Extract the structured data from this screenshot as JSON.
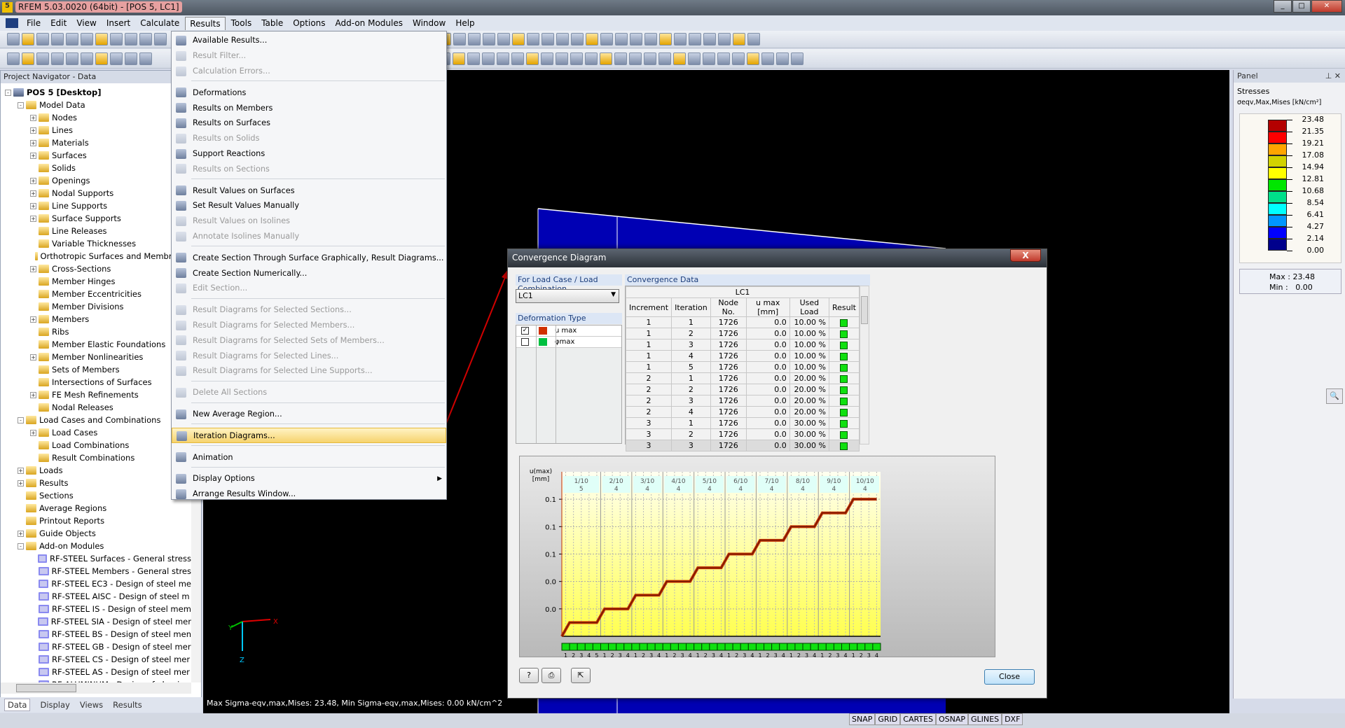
{
  "window": {
    "title": "RFEM 5.03.0020 (64bit) - [POS 5, LC1]"
  },
  "menubar": [
    "File",
    "Edit",
    "View",
    "Insert",
    "Calculate",
    "Results",
    "Tools",
    "Table",
    "Options",
    "Add-on Modules",
    "Window",
    "Help"
  ],
  "active_menu": "Results",
  "results_menu": [
    {
      "label": "Available Results...",
      "icon": "available-results-icon"
    },
    {
      "label": "Result Filter...",
      "disabled": true,
      "icon": "filter-icon"
    },
    {
      "label": "Calculation Errors...",
      "disabled": true,
      "icon": "warning-icon"
    },
    {
      "sep": true
    },
    {
      "label": "Deformations",
      "icon": "deformations-icon"
    },
    {
      "label": "Results on Members",
      "icon": "member-results-icon"
    },
    {
      "label": "Results on Surfaces",
      "icon": "surface-results-icon"
    },
    {
      "label": "Results on Solids",
      "disabled": true,
      "icon": "solid-results-icon"
    },
    {
      "label": "Support Reactions",
      "icon": "support-reactions-icon"
    },
    {
      "label": "Results on Sections",
      "disabled": true,
      "icon": "section-results-icon"
    },
    {
      "sep": true
    },
    {
      "label": "Result Values on Surfaces",
      "icon": "result-values-icon"
    },
    {
      "label": "Set Result Values Manually",
      "icon": "set-values-icon"
    },
    {
      "label": "Result Values on Isolines",
      "disabled": true,
      "icon": "isolines-icon"
    },
    {
      "label": "Annotate Isolines Manually",
      "disabled": true,
      "icon": "annotate-icon"
    },
    {
      "sep": true
    },
    {
      "label": "Create Section Through Surface Graphically, Result Diagrams...",
      "icon": "section-graphic-icon"
    },
    {
      "label": "Create Section Numerically...",
      "icon": "section-numeric-icon"
    },
    {
      "label": "Edit Section...",
      "disabled": true,
      "icon": "edit-section-icon"
    },
    {
      "sep": true
    },
    {
      "label": "Result Diagrams for Selected Sections...",
      "disabled": true,
      "icon": "diagram-icon"
    },
    {
      "label": "Result Diagrams for Selected Members...",
      "disabled": true,
      "icon": "diagram-icon"
    },
    {
      "label": "Result Diagrams for Selected Sets of Members...",
      "disabled": true,
      "icon": "diagram-icon"
    },
    {
      "label": "Result Diagrams for Selected Lines...",
      "disabled": true,
      "icon": "diagram-icon"
    },
    {
      "label": "Result Diagrams for Selected Line Supports...",
      "disabled": true,
      "icon": "diagram-icon"
    },
    {
      "sep": true
    },
    {
      "label": "Delete All Sections",
      "disabled": true,
      "icon": "delete-icon"
    },
    {
      "sep": true
    },
    {
      "label": "New Average Region...",
      "icon": "average-region-icon"
    },
    {
      "sep": true
    },
    {
      "label": "Iteration Diagrams...",
      "highlighted": true,
      "icon": "iteration-diagram-icon"
    },
    {
      "sep": true
    },
    {
      "label": "Animation",
      "icon": "animation-icon"
    },
    {
      "sep": true
    },
    {
      "label": "Display Options",
      "submenu": true,
      "icon": "display-options-icon"
    },
    {
      "label": "Arrange Results Window...",
      "icon": "arrange-icon"
    }
  ],
  "navigator": {
    "title": "Project Navigator - Data",
    "tree": [
      {
        "label": "POS 5 [Desktop]",
        "level": 0,
        "bold": true,
        "exp": "-"
      },
      {
        "label": "Model Data",
        "level": 1,
        "exp": "-"
      },
      {
        "label": "Nodes",
        "level": 2,
        "exp": "+"
      },
      {
        "label": "Lines",
        "level": 2,
        "exp": "+"
      },
      {
        "label": "Materials",
        "level": 2,
        "exp": "+"
      },
      {
        "label": "Surfaces",
        "level": 2,
        "exp": "+"
      },
      {
        "label": "Solids",
        "level": 2
      },
      {
        "label": "Openings",
        "level": 2,
        "exp": "+"
      },
      {
        "label": "Nodal Supports",
        "level": 2,
        "exp": "+"
      },
      {
        "label": "Line Supports",
        "level": 2,
        "exp": "+"
      },
      {
        "label": "Surface Supports",
        "level": 2,
        "exp": "+"
      },
      {
        "label": "Line Releases",
        "level": 2
      },
      {
        "label": "Variable Thicknesses",
        "level": 2
      },
      {
        "label": "Orthotropic Surfaces and Membranes",
        "level": 2
      },
      {
        "label": "Cross-Sections",
        "level": 2,
        "exp": "+"
      },
      {
        "label": "Member Hinges",
        "level": 2
      },
      {
        "label": "Member Eccentricities",
        "level": 2
      },
      {
        "label": "Member Divisions",
        "level": 2
      },
      {
        "label": "Members",
        "level": 2,
        "exp": "+"
      },
      {
        "label": "Ribs",
        "level": 2
      },
      {
        "label": "Member Elastic Foundations",
        "level": 2
      },
      {
        "label": "Member Nonlinearities",
        "level": 2,
        "exp": "+"
      },
      {
        "label": "Sets of Members",
        "level": 2
      },
      {
        "label": "Intersections of Surfaces",
        "level": 2
      },
      {
        "label": "FE Mesh Refinements",
        "level": 2,
        "exp": "+"
      },
      {
        "label": "Nodal Releases",
        "level": 2
      },
      {
        "label": "Load Cases and Combinations",
        "level": 1,
        "exp": "-"
      },
      {
        "label": "Load Cases",
        "level": 2,
        "exp": "+"
      },
      {
        "label": "Load Combinations",
        "level": 2
      },
      {
        "label": "Result Combinations",
        "level": 2
      },
      {
        "label": "Loads",
        "level": 1,
        "exp": "+"
      },
      {
        "label": "Results",
        "level": 1,
        "exp": "+"
      },
      {
        "label": "Sections",
        "level": 1
      },
      {
        "label": "Average Regions",
        "level": 1
      },
      {
        "label": "Printout Reports",
        "level": 1
      },
      {
        "label": "Guide Objects",
        "level": 1,
        "exp": "+"
      },
      {
        "label": "Add-on Modules",
        "level": 1,
        "exp": "-"
      },
      {
        "label": "RF-STEEL Surfaces - General stress",
        "level": 2,
        "mod": true
      },
      {
        "label": "RF-STEEL Members - General stres",
        "level": 2,
        "mod": true
      },
      {
        "label": "RF-STEEL EC3 - Design of steel me",
        "level": 2,
        "mod": true
      },
      {
        "label": "RF-STEEL AISC - Design of steel m",
        "level": 2,
        "mod": true
      },
      {
        "label": "RF-STEEL IS - Design of steel mem",
        "level": 2,
        "mod": true
      },
      {
        "label": "RF-STEEL SIA - Design of steel mer",
        "level": 2,
        "mod": true
      },
      {
        "label": "RF-STEEL BS - Design of steel men",
        "level": 2,
        "mod": true
      },
      {
        "label": "RF-STEEL GB - Design of steel mer",
        "level": 2,
        "mod": true
      },
      {
        "label": "RF-STEEL CS - Design of steel mer",
        "level": 2,
        "mod": true
      },
      {
        "label": "RF-STEEL AS - Design of steel mer",
        "level": 2,
        "mod": true
      },
      {
        "label": "RF-ALUMINUM - Design of alumi",
        "level": 2,
        "mod": true
      }
    ],
    "tabs": [
      "Data",
      "Display",
      "Views",
      "Results"
    ]
  },
  "viewport": {
    "status": "Max Sigma-eqv,max,Mises: 23.48, Min Sigma-eqv,max,Mises: 0.00 kN/cm^2",
    "axis_y": "Y",
    "axis_x": "X",
    "axis_z": "Z"
  },
  "panel": {
    "title": "Panel",
    "heading": "Stresses",
    "quantity": "σeqv,Max,Mises [kN/cm²]",
    "legend_values": [
      "23.48",
      "21.35",
      "19.21",
      "17.08",
      "14.94",
      "12.81",
      "10.68",
      "8.54",
      "6.41",
      "4.27",
      "2.14",
      "0.00"
    ],
    "legend_colors": [
      "#b40000",
      "#ff0000",
      "#ffa500",
      "#d2d200",
      "#ffff00",
      "#00e600",
      "#00e08a",
      "#00ffff",
      "#0096ff",
      "#0000ff",
      "#00008c"
    ],
    "max_label": "Max",
    "max": "23.48",
    "min_label": "Min",
    "min": "0.00"
  },
  "statusbar": [
    "SNAP",
    "GRID",
    "CARTES",
    "OSNAP",
    "GLINES",
    "DXF"
  ],
  "dialog": {
    "title": "Convergence Diagram",
    "load_case_header": "For Load Case / Load Combination",
    "load_case": "LC1",
    "deformation_header": "Deformation Type",
    "deformations": [
      {
        "label": "u max",
        "checked": true,
        "color": "#d03000"
      },
      {
        "label": "φmax",
        "checked": false,
        "color": "#00c040"
      }
    ],
    "data_header": "Convergence Data",
    "table_group": "LC1",
    "columns": [
      "Increment",
      "Iteration",
      "Node No.",
      "u max [mm]",
      "Used Load",
      "Result"
    ],
    "rows": [
      [
        "1",
        "1",
        "1726",
        "0.0",
        "10.00 %"
      ],
      [
        "1",
        "2",
        "1726",
        "0.0",
        "10.00 %"
      ],
      [
        "1",
        "3",
        "1726",
        "0.0",
        "10.00 %"
      ],
      [
        "1",
        "4",
        "1726",
        "0.0",
        "10.00 %"
      ],
      [
        "1",
        "5",
        "1726",
        "0.0",
        "10.00 %"
      ],
      [
        "2",
        "1",
        "1726",
        "0.0",
        "20.00 %"
      ],
      [
        "2",
        "2",
        "1726",
        "0.0",
        "20.00 %"
      ],
      [
        "2",
        "3",
        "1726",
        "0.0",
        "20.00 %"
      ],
      [
        "2",
        "4",
        "1726",
        "0.0",
        "20.00 %"
      ],
      [
        "3",
        "1",
        "1726",
        "0.0",
        "30.00 %"
      ],
      [
        "3",
        "2",
        "1726",
        "0.0",
        "30.00 %"
      ],
      [
        "3",
        "3",
        "1726",
        "0.0",
        "30.00 %"
      ]
    ],
    "result_color": "#10e010",
    "close_label": "Close"
  },
  "chart_data": {
    "type": "line",
    "ylabel": "u(max)\n[mm]",
    "ytick_labels": [
      "0.0",
      "0.0",
      "0.1",
      "0.1",
      "0.1"
    ],
    "yticks": [
      0.02,
      0.04,
      0.06,
      0.08,
      0.1
    ],
    "ylim": [
      0,
      0.12
    ],
    "increments": [
      {
        "label": "1/10",
        "iterations": 5,
        "values": [
          0,
          0.01,
          0.01,
          0.01,
          0.01
        ]
      },
      {
        "label": "2/10",
        "iterations": 4,
        "values": [
          0.02,
          0.02,
          0.02,
          0.02
        ]
      },
      {
        "label": "3/10",
        "iterations": 4,
        "values": [
          0.03,
          0.03,
          0.03,
          0.03
        ]
      },
      {
        "label": "4/10",
        "iterations": 4,
        "values": [
          0.04,
          0.04,
          0.04,
          0.04
        ]
      },
      {
        "label": "5/10",
        "iterations": 4,
        "values": [
          0.05,
          0.05,
          0.05,
          0.05
        ]
      },
      {
        "label": "6/10",
        "iterations": 4,
        "values": [
          0.06,
          0.06,
          0.06,
          0.06
        ]
      },
      {
        "label": "7/10",
        "iterations": 4,
        "values": [
          0.07,
          0.07,
          0.07,
          0.07
        ]
      },
      {
        "label": "8/10",
        "iterations": 4,
        "values": [
          0.08,
          0.08,
          0.08,
          0.08
        ]
      },
      {
        "label": "9/10",
        "iterations": 4,
        "values": [
          0.09,
          0.09,
          0.09,
          0.09
        ]
      },
      {
        "label": "10/10",
        "iterations": 4,
        "values": [
          0.1,
          0.1,
          0.1,
          0.1
        ]
      }
    ],
    "line_color": "#c03000",
    "grid": true
  }
}
